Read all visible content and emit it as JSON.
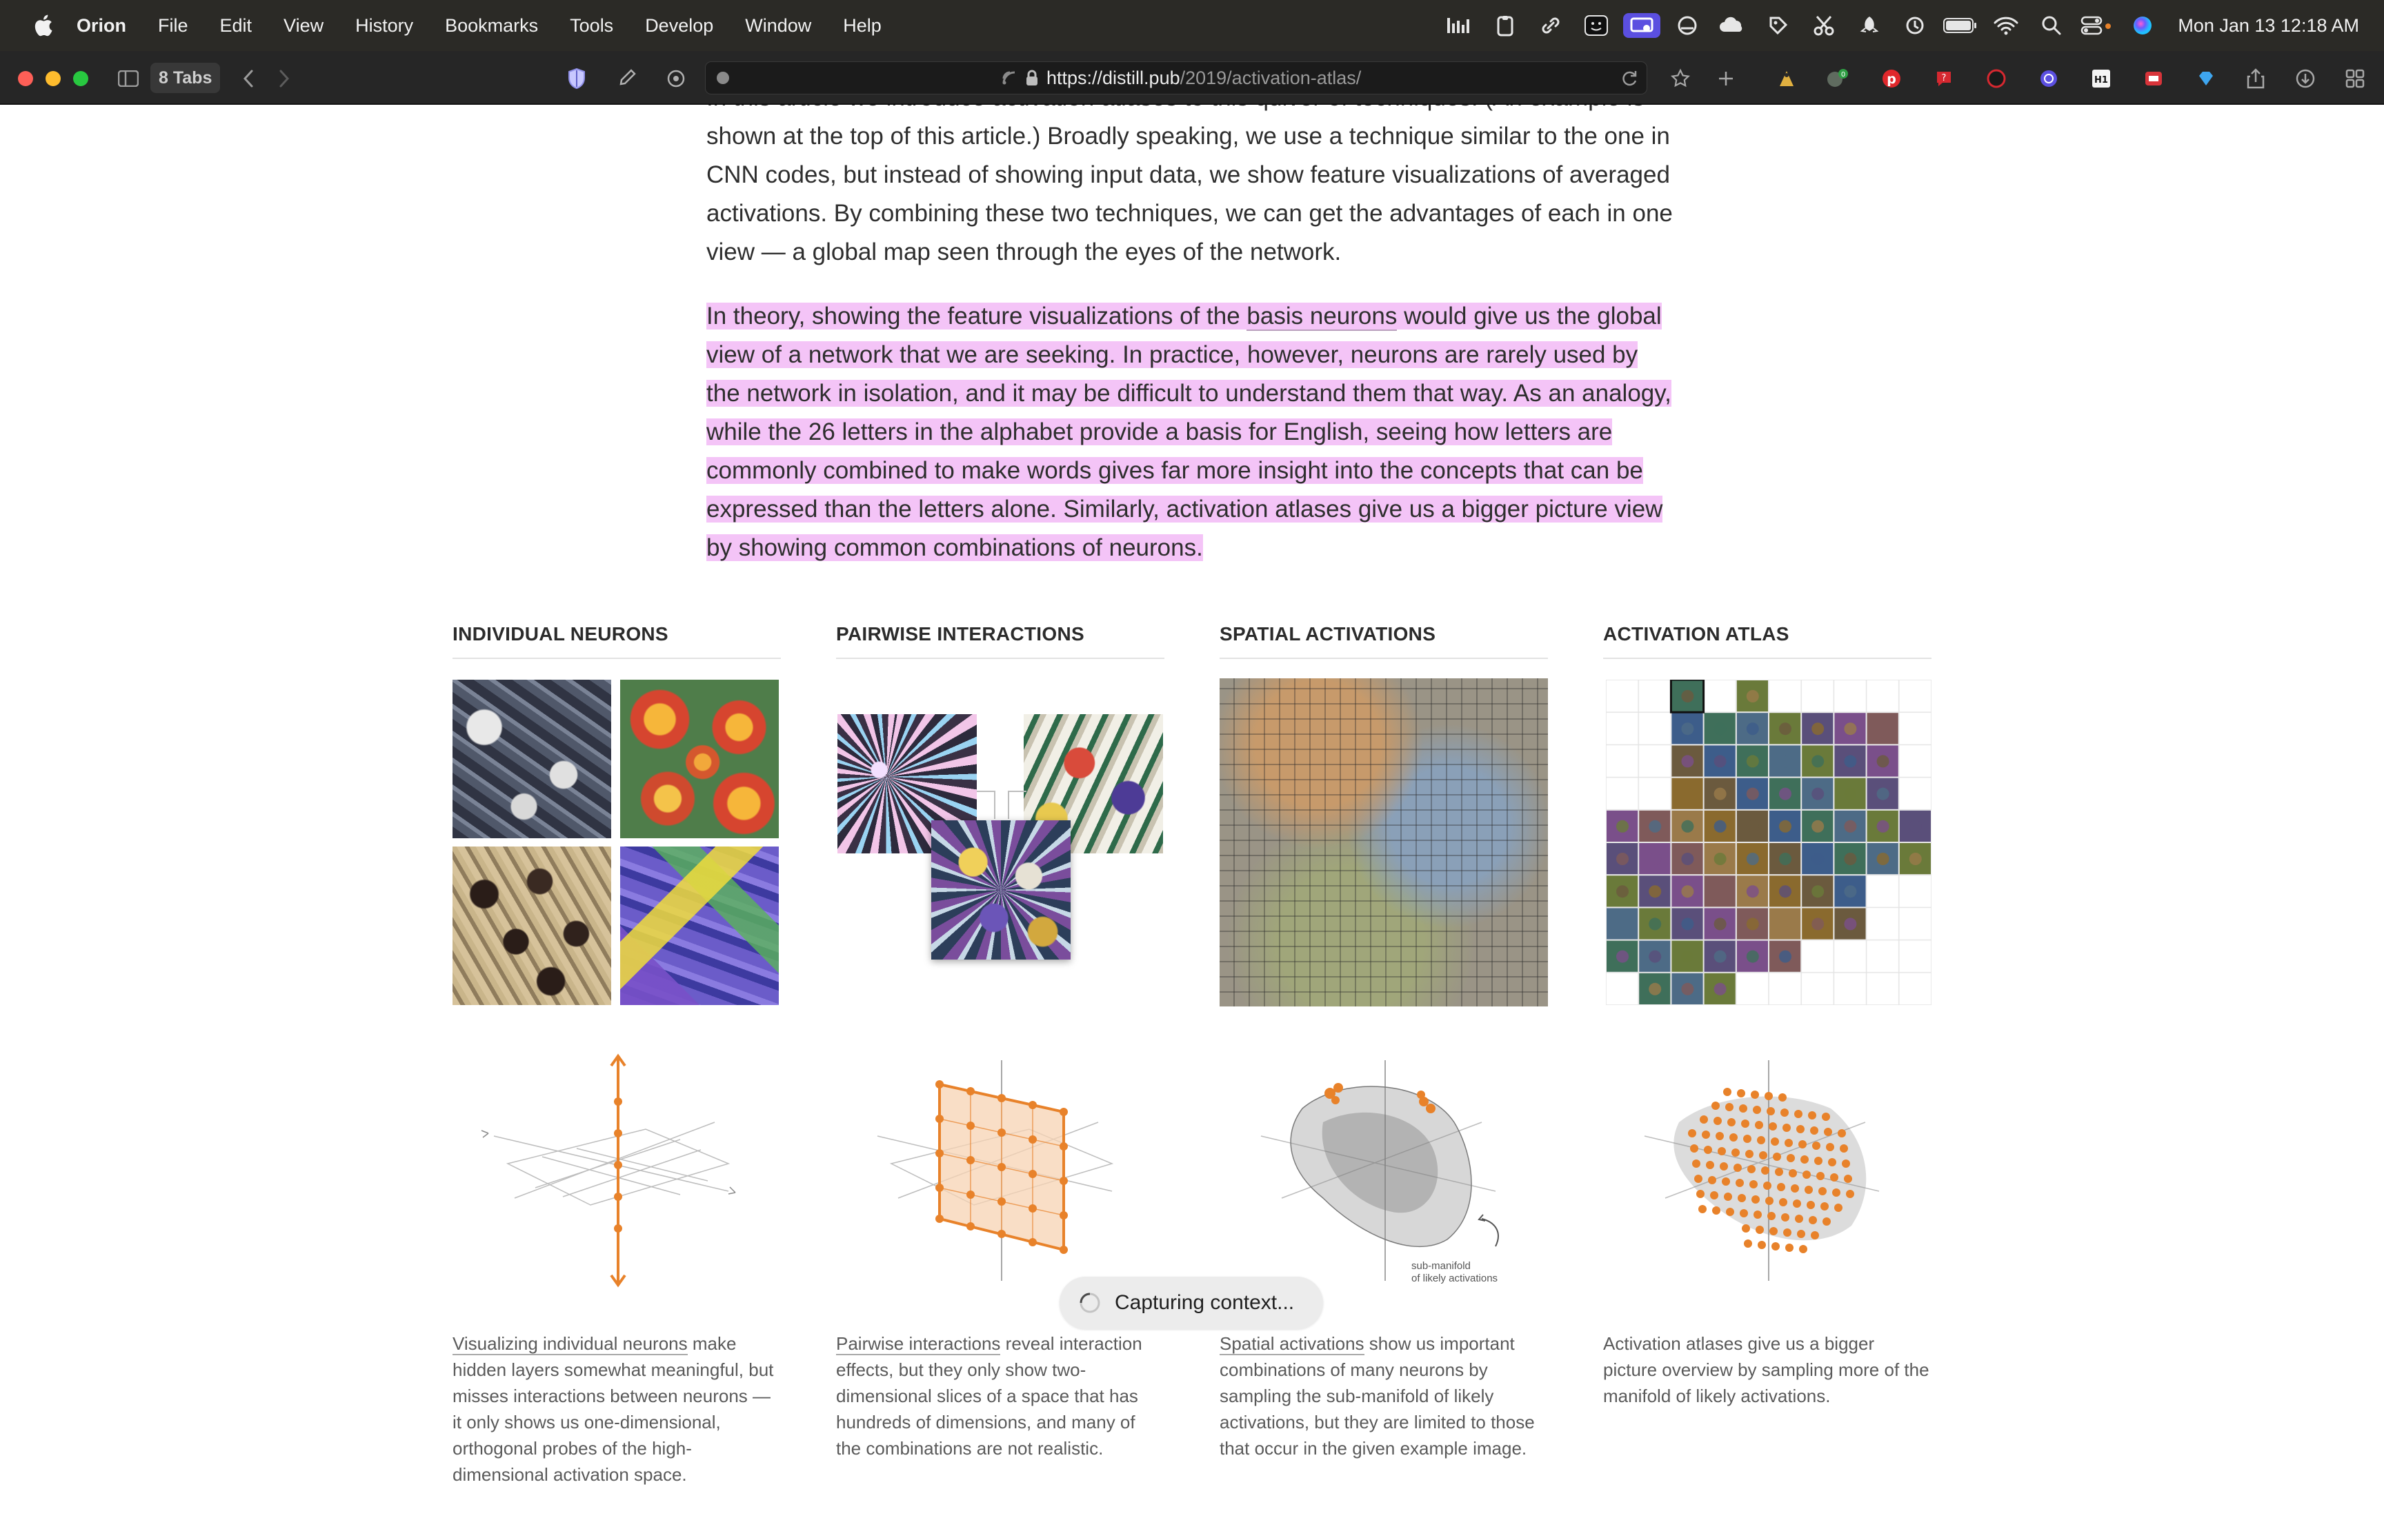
{
  "menubar": {
    "app_name": "Orion",
    "menus": [
      "File",
      "Edit",
      "View",
      "History",
      "Bookmarks",
      "Tools",
      "Develop",
      "Window",
      "Help"
    ],
    "clock": "Mon Jan 13  12:18 AM"
  },
  "browser": {
    "tab_count": "8 Tabs",
    "url_host": "https://distill.pub",
    "url_path": "/2019/activation-atlas/"
  },
  "article": {
    "para1_lines": [
      "In this article we introduce activation atlases to this quiver of techniques. (An example is",
      "shown at the top of this article.) Broadly speaking, we use a technique similar to the one in",
      "CNN codes, but instead of showing input data, we show feature visualizations of averaged",
      "activations. By combining these two techniques, we can get the advantages of each in one",
      "view — a global map seen through the eyes of the network."
    ],
    "para2_pre": "In theory, showing the feature visualizations of the ",
    "para2_link": "basis neurons",
    "para2_post": " would give us the global view of a network that we are seeking. In practice, however, neurons are rarely used by the network in isolation, and it may be difficult to understand them that way. As an analogy, while the 26 letters in the alphabet provide a basis for English, seeing how letters are commonly combined to make words gives far more insight into the concepts that can be expressed than the letters alone. Similarly, activation atlases give us a bigger picture view by showing common combinations of neurons."
  },
  "figures": {
    "columns": [
      {
        "heading": "INDIVIDUAL NEURONS",
        "caption_link": "Visualizing individual neurons",
        "caption_rest": " make hidden layers somewhat meaningful, but misses interactions between neurons — it only shows us one-dimensional, orthogonal probes of the high-dimensional activation space."
      },
      {
        "heading": "PAIRWISE INTERACTIONS",
        "caption_link": "Pairwise interactions",
        "caption_rest": " reveal interaction effects, but they only show two-dimensional slices of a space that has hundreds of dimensions, and many of the combinations are not realistic."
      },
      {
        "heading": "SPATIAL ACTIVATIONS",
        "caption_link": "Spatial activations",
        "caption_rest": " show us important combinations of many neurons by sampling the sub-manifold of likely activations, but they are limited to those that occur in the given example image."
      },
      {
        "heading": "ACTIVATION ATLAS",
        "caption_link": "",
        "caption_rest": "Activation atlases give us a bigger picture overview by sampling more of the manifold of likely activations."
      }
    ],
    "submanifold_label_line1": "sub-manifold",
    "submanifold_label_line2": "of likely activations"
  },
  "overlay": {
    "status": "Capturing context..."
  },
  "colors": {
    "highlight": "#f4c4f7",
    "accent_orange": "#e8822a",
    "menubar_bg": "#2b2a26",
    "toolbar_bg": "#262626"
  }
}
